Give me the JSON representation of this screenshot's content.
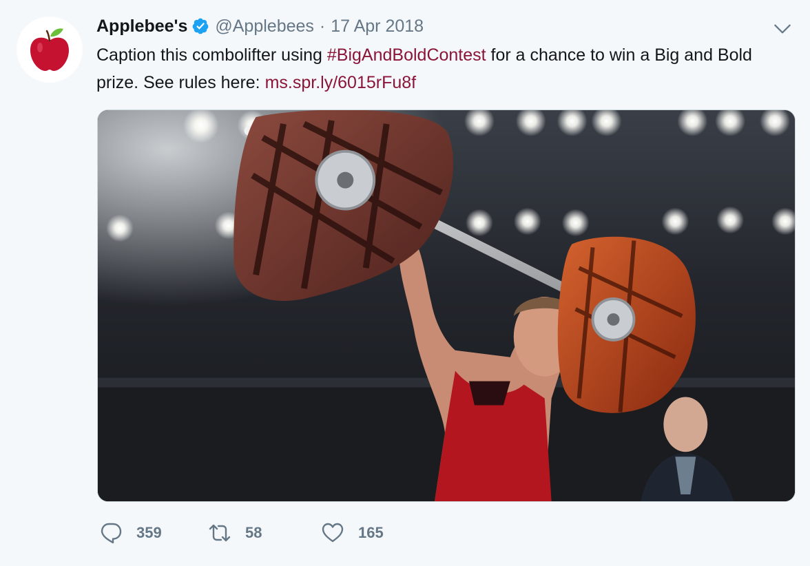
{
  "author": {
    "display_name": "Applebee's",
    "handle": "@Applebees",
    "separator": "·",
    "date": "17 Apr 2018",
    "verified": true,
    "avatar_icon": "apple-logo-icon"
  },
  "tweet": {
    "text_before": "Caption this combolifter using ",
    "hashtag": "#BigAndBoldContest",
    "text_middle": " for a chance to win a Big and Bold prize. See rules here: ",
    "link": "ms.spr.ly/6015rFu8f"
  },
  "media": {
    "type": "photo",
    "description_icon": "photo-weightlifter-steak-barbell"
  },
  "actions": {
    "reply_count": "359",
    "retweet_count": "58",
    "like_count": "165"
  },
  "colors": {
    "link": "#8a1538",
    "secondary_text": "#657786",
    "verified": "#1da1f2",
    "background": "#f5f8fa"
  }
}
